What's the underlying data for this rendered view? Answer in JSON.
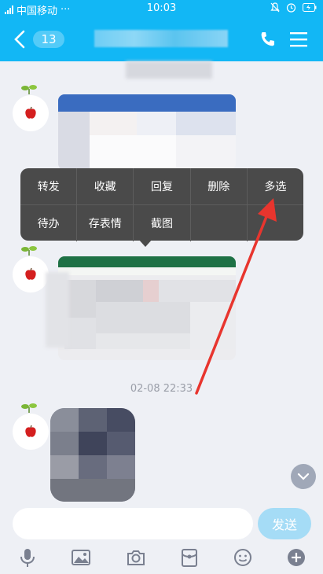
{
  "status_bar": {
    "carrier": "中国移动",
    "dots": "···",
    "time": "10:03"
  },
  "nav": {
    "unread_count": "13"
  },
  "context_menu": {
    "row1": [
      "转发",
      "收藏",
      "回复",
      "删除",
      "多选"
    ],
    "row2": [
      "待办",
      "存表情",
      "截图"
    ]
  },
  "timestamp": "02-08 22:33",
  "composer": {
    "send_label": "发送"
  },
  "colors": {
    "brand": "#12b7f5",
    "annotation_arrow": "#e8352e"
  }
}
